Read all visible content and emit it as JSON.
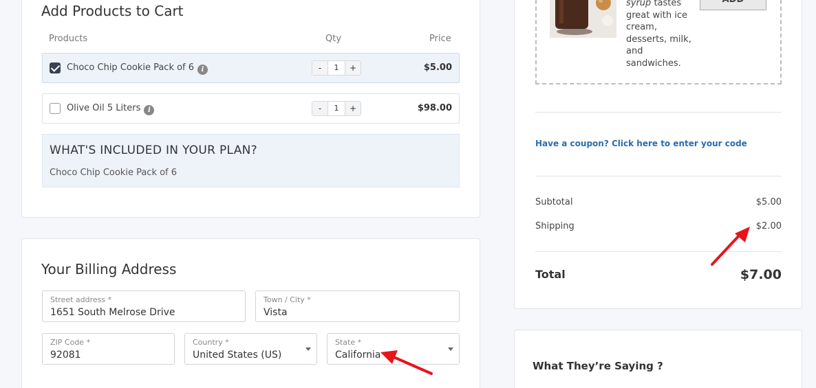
{
  "products": {
    "title": "Add Products to Cart",
    "headers": {
      "products": "Products",
      "qty": "Qty",
      "price": "Price"
    },
    "items": [
      {
        "name": "Choco Chip Cookie Pack of 6",
        "qty": "1",
        "price": "$5.00",
        "checked": true
      },
      {
        "name": "Olive Oil 5 Liters",
        "qty": "1",
        "price": "$98.00",
        "checked": false
      }
    ],
    "stepper": {
      "minus": "-",
      "plus": "+"
    },
    "info_glyph": "i",
    "plan": {
      "title": "WHAT'S INCLUDED IN YOUR PLAN?",
      "items": [
        "Choco Chip Cookie Pack of 6"
      ]
    }
  },
  "billing": {
    "title": "Your Billing Address",
    "fields": {
      "street": {
        "label": "Street address *",
        "value": "1651 South Melrose Drive"
      },
      "city": {
        "label": "Town / City *",
        "value": "Vista"
      },
      "zip": {
        "label": "ZIP Code *",
        "value": "92081"
      },
      "country": {
        "label": "Country *",
        "value": "United States (US)"
      },
      "state": {
        "label": "State *",
        "value": "California"
      }
    }
  },
  "upsell": {
    "text_italic": "syrup",
    "text_rest": " tastes great with ice cream, desserts, milk, and sandwiches.",
    "add_label": "ADD"
  },
  "summary": {
    "coupon_link": "Have a coupon? Click here to enter your code",
    "subtotal_label": "Subtotal",
    "subtotal_value": "$5.00",
    "shipping_label": "Shipping",
    "shipping_value": "$2.00",
    "total_label": "Total",
    "total_value": "$7.00"
  },
  "testimonials": {
    "title": "What They’re Saying ?"
  },
  "colors": {
    "accent_link": "#2b6cb0",
    "annotation_arrow": "#e8141b",
    "selected_row": "#eef3fa"
  }
}
